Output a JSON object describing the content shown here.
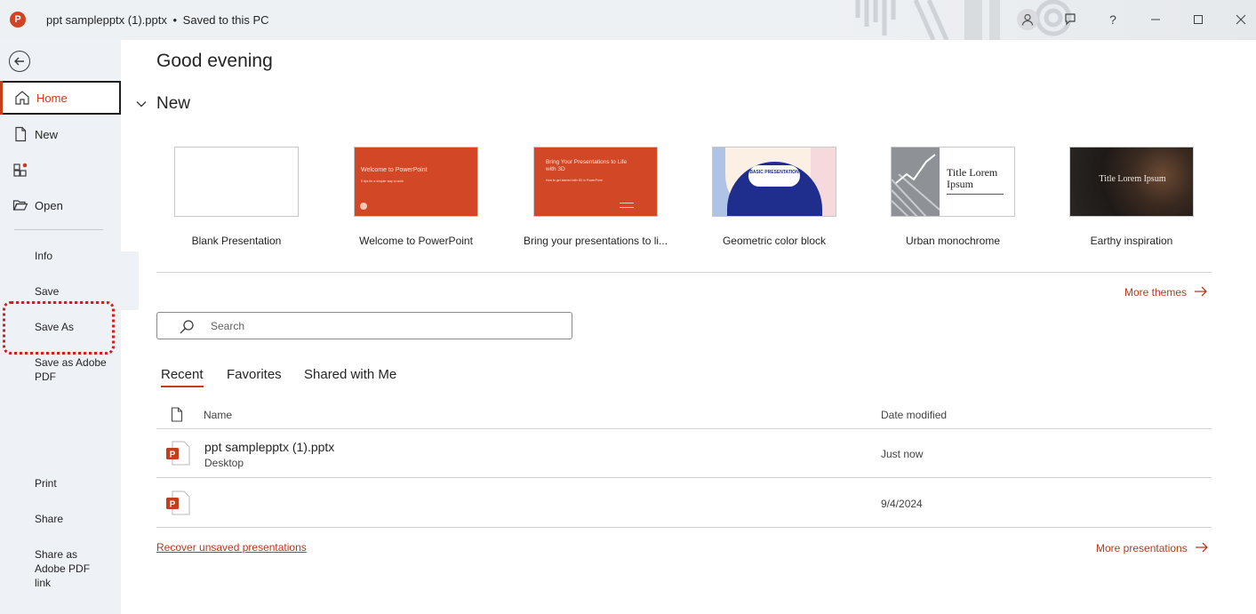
{
  "titlebar": {
    "filename": "ppt samplepptx (1).pptx",
    "separator": "•",
    "save_status": "Saved to this PC",
    "app_logo_letter": "P",
    "help_label": "?"
  },
  "sidebar": {
    "home": "Home",
    "new": "New",
    "open": "Open",
    "info": "Info",
    "save": "Save",
    "save_as": "Save As",
    "save_as_pdf": "Save as Adobe PDF",
    "print": "Print",
    "share": "Share",
    "share_pdf_link": "Share as Adobe PDF link"
  },
  "main": {
    "greeting": "Good evening",
    "new_section": "New",
    "templates": [
      {
        "caption": "Blank Presentation"
      },
      {
        "caption": "Welcome to PowerPoint",
        "thumb_title": "Welcome to PowerPoint",
        "thumb_sub": "5 tips for a simpler way to work"
      },
      {
        "caption": "Bring your presentations to li...",
        "thumb_title": "Bring Your Presentations to Life with 3D",
        "thumb_sub": "How to get started with 3D in PowerPoint"
      },
      {
        "caption": "Geometric color block",
        "thumb_title": "BASIC PRESENTATION"
      },
      {
        "caption": "Urban monochrome",
        "thumb_title": "Title Lorem Ipsum"
      },
      {
        "caption": "Earthy inspiration",
        "thumb_title": "Title Lorem Ipsum"
      }
    ],
    "more_themes": "More themes",
    "search_placeholder": "Search",
    "tabs": [
      "Recent",
      "Favorites",
      "Shared with Me"
    ],
    "columns": {
      "name": "Name",
      "date": "Date modified"
    },
    "files": [
      {
        "name": "ppt samplepptx (1).pptx",
        "location": "Desktop",
        "date": "Just now"
      },
      {
        "name": "",
        "location": "",
        "date": "9/4/2024"
      }
    ],
    "recover_link": "Recover unsaved presentations",
    "more_presentations": "More presentations"
  },
  "colors": {
    "accent": "#c43e1c",
    "sidebar_bg": "#eef1f5",
    "annotation": "#d21e1e"
  }
}
